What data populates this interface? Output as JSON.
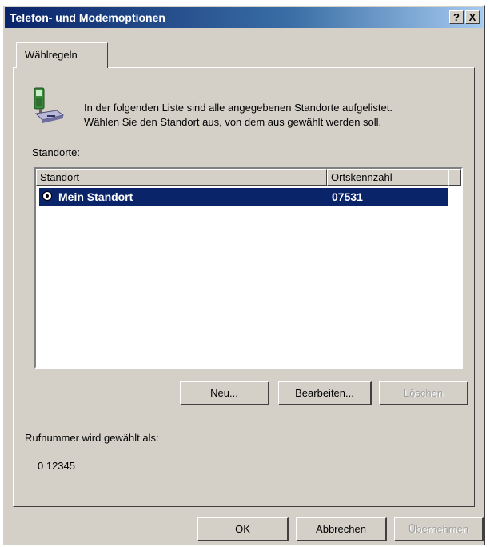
{
  "window": {
    "title": "Telefon- und Modemoptionen",
    "help_button": "?",
    "close_button": "X"
  },
  "tabs": [
    {
      "label": "Wählregeln",
      "active": true
    }
  ],
  "info": {
    "icon": "phone-modem-icon",
    "line1": "In der folgenden Liste sind alle angegebenen Standorte aufgelistet.",
    "line2": "Wählen Sie den Standort aus, von dem aus gewählt werden soll."
  },
  "locations": {
    "label": "Standorte:",
    "columns": [
      "Standort",
      "Ortskennzahl"
    ],
    "rows": [
      {
        "name": "Mein Standort",
        "area_code": "07531",
        "selected": true
      }
    ]
  },
  "location_buttons": {
    "new": "Neu...",
    "edit": "Bearbeiten...",
    "delete": "Löschen"
  },
  "dial": {
    "label": "Rufnummer wird gewählt als:",
    "value": "0 12345"
  },
  "dialog_buttons": {
    "ok": "OK",
    "cancel": "Abbrechen",
    "apply": "Übernehmen"
  },
  "colors": {
    "titlebar_start": "#0a246a",
    "titlebar_end": "#a6caf0",
    "selection": "#0a246a",
    "face": "#d4d0c8"
  }
}
